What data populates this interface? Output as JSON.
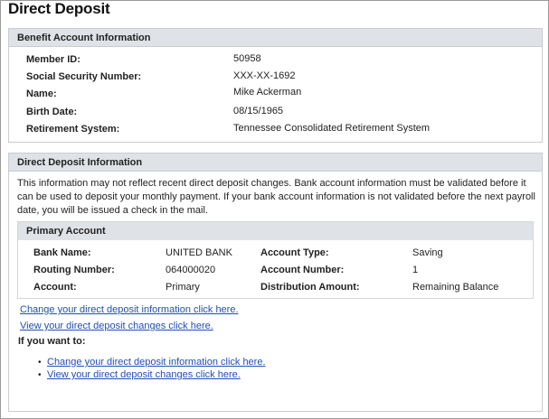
{
  "page": {
    "title": "Direct Deposit"
  },
  "benefit": {
    "header": "Benefit Account Information",
    "rows": [
      {
        "label": "Member ID:",
        "value": "50958"
      },
      {
        "label": "Social Security Number:",
        "value": "XXX-XX-1692"
      },
      {
        "label": "Name:",
        "value": "Mike Ackerman"
      },
      {
        "label": "Birth Date:",
        "value": "08/15/1965"
      },
      {
        "label": "Retirement System:",
        "value": "Tennessee Consolidated Retirement System"
      }
    ]
  },
  "deposit": {
    "header": "Direct Deposit Information",
    "notice": "This information may not reflect recent direct deposit changes. Bank account information must be validated before it can be used to deposit your monthly payment. If your bank account information is not validated before the next payroll date, you will be issued a check in the mail.",
    "primary": {
      "header": "Primary Account",
      "bank_name_label": "Bank Name:",
      "bank_name": "UNITED BANK",
      "routing_label": "Routing Number:",
      "routing": "064000020",
      "account_label": "Account:",
      "account": "Primary",
      "type_label": "Account Type:",
      "type": "Saving",
      "number_label": "Account Number:",
      "number": "1",
      "distribution_label": "Distribution Amount:",
      "distribution": "Remaining Balance"
    },
    "links": {
      "change": "Change your direct deposit information click here.",
      "view": "View your direct deposit changes click here."
    },
    "if_you_want": "If you want to:",
    "bullet_links": {
      "change": "Change your direct deposit information click here.",
      "view": "View your direct deposit changes click here."
    }
  },
  "colors": {
    "header_bg": "#dfe3e8",
    "link": "#1f4fb5",
    "border": "#c9ccd1"
  }
}
